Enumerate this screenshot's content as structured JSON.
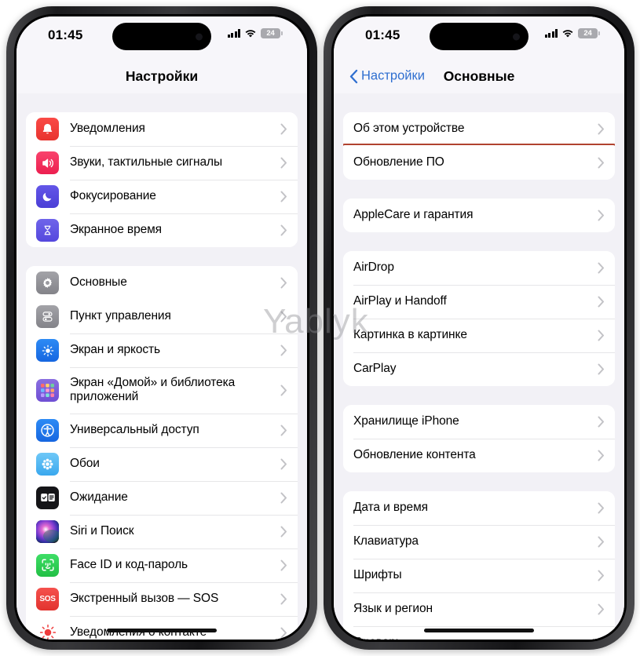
{
  "watermark": "Yablyk",
  "status": {
    "time": "01:45",
    "battery": "24"
  },
  "left_phone": {
    "nav_title": "Настройки",
    "sections": [
      {
        "rows": [
          {
            "label": "Уведомления",
            "icon": "bell-icon"
          },
          {
            "label": "Звуки, тактильные сигналы",
            "icon": "speaker-icon"
          },
          {
            "label": "Фокусирование",
            "icon": "moon-icon"
          },
          {
            "label": "Экранное время",
            "icon": "hourglass-icon"
          }
        ]
      },
      {
        "rows": [
          {
            "label": "Основные",
            "icon": "gear-icon",
            "highlighted": true
          },
          {
            "label": "Пункт управления",
            "icon": "control-center-icon"
          },
          {
            "label": "Экран и яркость",
            "icon": "brightness-icon"
          },
          {
            "label": "Экран «Домой» и библиотека приложений",
            "icon": "home-screen-icon"
          },
          {
            "label": "Универсальный доступ",
            "icon": "accessibility-icon"
          },
          {
            "label": "Обои",
            "icon": "wallpaper-icon"
          },
          {
            "label": "Ожидание",
            "icon": "standby-icon"
          },
          {
            "label": "Siri и Поиск",
            "icon": "siri-icon"
          },
          {
            "label": "Face ID и код-пароль",
            "icon": "faceid-icon"
          },
          {
            "label": "Экстренный вызов — SOS",
            "icon": "sos-icon"
          },
          {
            "label": "Уведомления о контакте",
            "icon": "contact-alert-icon"
          }
        ]
      }
    ]
  },
  "right_phone": {
    "nav_back": "Настройки",
    "nav_title": "Основные",
    "sections": [
      {
        "rows": [
          {
            "label": "Об этом устройстве"
          },
          {
            "label": "Обновление ПО",
            "highlighted": true
          }
        ]
      },
      {
        "rows": [
          {
            "label": "AppleCare и гарантия"
          }
        ]
      },
      {
        "rows": [
          {
            "label": "AirDrop"
          },
          {
            "label": "AirPlay и Handoff"
          },
          {
            "label": "Картинка в картинке"
          },
          {
            "label": "CarPlay"
          }
        ]
      },
      {
        "rows": [
          {
            "label": "Хранилище iPhone"
          },
          {
            "label": "Обновление контента"
          }
        ]
      },
      {
        "rows": [
          {
            "label": "Дата и время"
          },
          {
            "label": "Клавиатура"
          },
          {
            "label": "Шрифты"
          },
          {
            "label": "Язык и регион"
          },
          {
            "label": "Словарь"
          }
        ]
      }
    ]
  },
  "colors": {
    "highlight_border": "#b1422f",
    "accent_blue": "#2f6fd0",
    "page_bg": "#f2f1f6"
  }
}
